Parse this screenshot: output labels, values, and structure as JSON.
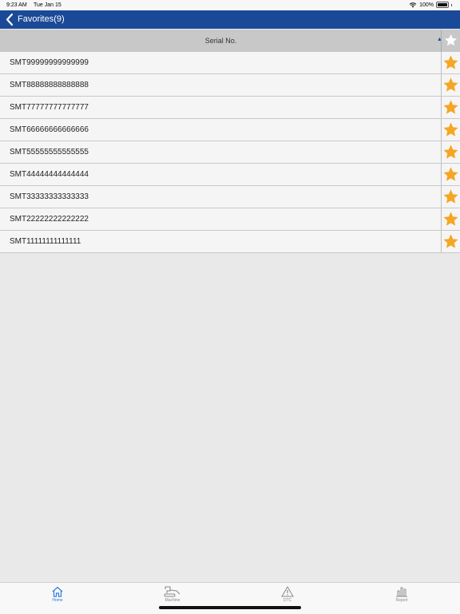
{
  "status_bar": {
    "time": "9:23 AM",
    "date": "Tue Jan 15",
    "battery": "100%"
  },
  "nav": {
    "title": "Favorites(9)"
  },
  "table": {
    "column_header": "Serial No.",
    "sort": "ascending",
    "rows": [
      {
        "serial": "SMT99999999999999",
        "favorite": true
      },
      {
        "serial": "SMT88888888888888",
        "favorite": true
      },
      {
        "serial": "SMT77777777777777",
        "favorite": true
      },
      {
        "serial": "SMT66666666666666",
        "favorite": true
      },
      {
        "serial": "SMT55555555555555",
        "favorite": true
      },
      {
        "serial": "SMT44444444444444",
        "favorite": true
      },
      {
        "serial": "SMT33333333333333",
        "favorite": true
      },
      {
        "serial": "SMT22222222222222",
        "favorite": true
      },
      {
        "serial": "SMT11111111111111",
        "favorite": true
      }
    ]
  },
  "tabs": [
    {
      "label": "Home",
      "icon": "home-icon",
      "active": true
    },
    {
      "label": "Machine",
      "icon": "excavator-icon",
      "active": false
    },
    {
      "label": "DTC",
      "icon": "warning-icon",
      "active": false
    },
    {
      "label": "Report",
      "icon": "bar-chart-icon",
      "active": false
    }
  ],
  "colors": {
    "nav": "#1a4a97",
    "star": "#f5a623",
    "active_tab": "#2f7de1"
  }
}
